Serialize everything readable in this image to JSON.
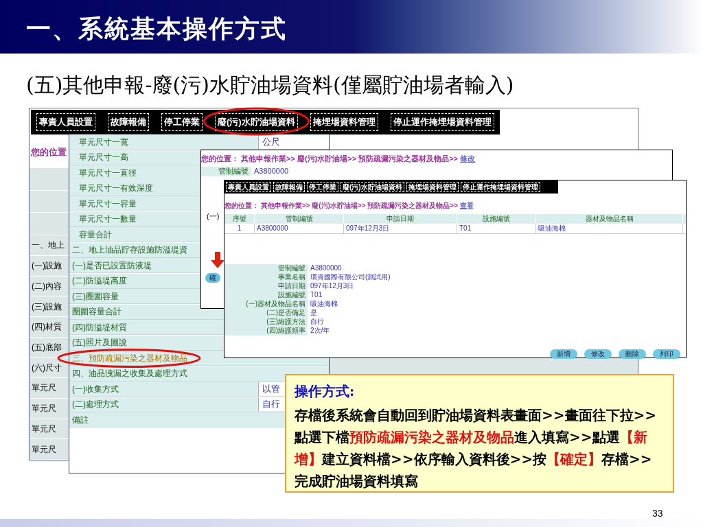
{
  "title": "一、系統基本操作方式",
  "subtitle": "(五)其他申報-廢(污)水貯油場資料(僅屬貯油場者輸入)",
  "main_window": {
    "tabs": [
      "專責人員設置",
      "故障報備",
      "停工停業",
      "廢(污)水貯油場資料",
      "掩埋場資料管理",
      "停止運作掩埋場資料管理"
    ],
    "breadcrumb": "您的位置",
    "rows": [
      "一、地上",
      "(一)設施",
      "(二)內容",
      "(三)設施",
      "(四)材質",
      "(五)底部",
      "(六)尺寸",
      "單元尺",
      "單元尺",
      "單元尺",
      "單元尺"
    ]
  },
  "list_window": {
    "items": [
      {
        "label": "單元尺寸一寬",
        "value": "公尺",
        "selected": false
      },
      {
        "label": "單元尺寸一高",
        "selected": false
      },
      {
        "label": "單元尺寸一直徑",
        "selected": false
      },
      {
        "label": "單元尺寸一有效深度",
        "selected": false
      },
      {
        "label": "單元尺寸一容量",
        "selected": false
      },
      {
        "label": "單元尺寸一數量",
        "selected": false
      },
      {
        "label": "容量合計",
        "selected": false
      },
      {
        "label": "二、地上油品貯存設施防溢堤資",
        "selected": false
      },
      {
        "label": "(一)是否已設置防液堤",
        "selected": false
      },
      {
        "label": "(二)防溢堤高度",
        "selected": false
      },
      {
        "label": "(三)圈圍容量",
        "selected": false
      },
      {
        "label": "圈圍容量合計",
        "selected": false
      },
      {
        "label": "(四)防溢堤材質",
        "selected": false
      },
      {
        "label": "(五)照片及圖說",
        "selected": false
      },
      {
        "label": "三、預防疏漏污染之器材及物品",
        "selected": true
      },
      {
        "label": "四、油品洩漏之收集及處理方式",
        "selected": false
      },
      {
        "label": "(一)收集方式",
        "value": "以管",
        "selected": false
      },
      {
        "label": "(二)處理方式",
        "value": "自行",
        "selected": false
      },
      {
        "label": "備註",
        "selected": false
      }
    ]
  },
  "edit_window": {
    "breadcrumb": "您的位置： 其他申報作業>> 廢(污)水貯油場>> 預防疏漏污染之器材及物品>> ",
    "link": "修改",
    "field": {
      "label": "管制編號",
      "value": "A3800000"
    },
    "row_label": "(一)",
    "confirm_button": "確"
  },
  "view_window": {
    "tabs": [
      "專責人員設置",
      "故障報備",
      "停工停業",
      "廢(污)水貯油場資料",
      "掩埋場資料管理",
      "停止運作掩埋場資料管理"
    ],
    "breadcrumb": "您的位置： 其他申報作業>> 廢(污)水貯油場>> 預防疏漏污染之器材及物品>> ",
    "link": "查看",
    "table": {
      "columns": [
        "序號",
        "管制編號",
        "申請日期",
        "設施編號",
        "器材及物品名稱"
      ],
      "rows": [
        [
          "1",
          "A3800000",
          "097年12月3日",
          "T01",
          "吸油海棉"
        ]
      ]
    },
    "fields": [
      {
        "label": "管制編號",
        "value": "A3800000"
      },
      {
        "label": "事業名稱",
        "value": "環資國際有限公司(測試用)"
      },
      {
        "label": "申請日期",
        "value": "097年12月3日"
      },
      {
        "label": "設施編號",
        "value": "T01"
      },
      {
        "label": "(一)器材及物品名稱",
        "value": "吸油海棉"
      },
      {
        "label": "(二)是否備足",
        "value": "是"
      },
      {
        "label": "(三)維護方法",
        "value": "自行"
      },
      {
        "label": "(四)維護頻率",
        "value": "2次/年"
      }
    ],
    "buttons": [
      "新增",
      "修改",
      "刪除",
      "列印"
    ]
  },
  "note": {
    "heading": "操作方式:",
    "parts": [
      {
        "text": "存檔後系統會自動回到貯油場資料表畫面>>畫面往下拉>>點選下檔",
        "kind": "plain"
      },
      {
        "text": "預防疏漏污染之器材及物品",
        "kind": "highlight"
      },
      {
        "text": "進入填寫>>點選",
        "kind": "plain"
      },
      {
        "text": "【新增】",
        "kind": "highlight"
      },
      {
        "text": "建立資料檔>>依序輸入資料後>>按",
        "kind": "plain"
      },
      {
        "text": "【確定】",
        "kind": "highlight"
      },
      {
        "text": "存檔>>完成貯油場資料填寫",
        "kind": "plain"
      }
    ]
  },
  "page_number": "33"
}
